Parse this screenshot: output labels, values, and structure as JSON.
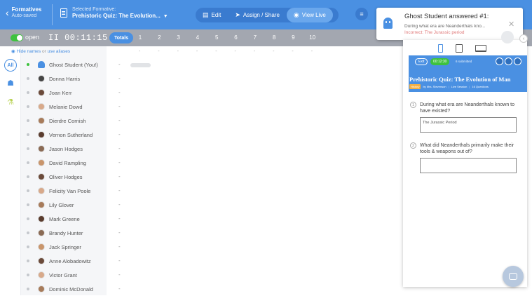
{
  "header": {
    "back_title": "Formatives",
    "back_status": "Auto-saved",
    "selected_label": "Selected Formative:",
    "selected_name": "Prehistoric Quiz: The Evolution...",
    "tabs": [
      {
        "label": "Edit",
        "icon": "edit-icon"
      },
      {
        "label": "Assign / Share",
        "icon": "send-icon"
      },
      {
        "label": "View Live",
        "icon": "eye-icon"
      }
    ],
    "active_tab": "View Live",
    "accent_color": "#4a90e2"
  },
  "subbar": {
    "open_label": "open",
    "timer": "II 00:11:15",
    "totals_label": "Totals",
    "question_numbers": [
      "1",
      "2",
      "3",
      "4",
      "5",
      "6",
      "7",
      "8",
      "9",
      "10"
    ]
  },
  "sidebar": {
    "all_label": "All",
    "hide_names": "Hide names",
    "or": "or",
    "use_aliases": "use aliases",
    "students": [
      {
        "name": "Ghost Student (You!)",
        "live": true,
        "avatar": "ghost"
      },
      {
        "name": "Donna Harris"
      },
      {
        "name": "Joan Kerr"
      },
      {
        "name": "Melanie Dowd"
      },
      {
        "name": "Dierdre Cornish"
      },
      {
        "name": "Vernon Sutherland"
      },
      {
        "name": "Jason Hodges"
      },
      {
        "name": "David Rampling"
      },
      {
        "name": "Oliver Hodges"
      },
      {
        "name": "Felicity Van Poole"
      },
      {
        "name": "Lily Glover"
      },
      {
        "name": "Mark Greene"
      },
      {
        "name": "Brandy Hunter"
      },
      {
        "name": "Jack Springer"
      },
      {
        "name": "Anne Alobadowitz"
      },
      {
        "name": "Victor Grant"
      },
      {
        "name": "Dominic McDonald"
      }
    ],
    "row_dash": "-"
  },
  "notification": {
    "title": "Ghost Student answered #1:",
    "question": "During what era are Neanderthals kno...",
    "answer": "Incorrect: The Jurassic period"
  },
  "preview": {
    "exit_label": "Exit",
    "timer": "00:12:30",
    "status": "6 submitted",
    "title": "Prehistoric Quiz: The Evolution of Man",
    "subject_badge": "History",
    "by": "by Mrs. Stevenson",
    "mode": "Live Session",
    "count": "16 Questions",
    "questions": [
      {
        "num": "1",
        "text": "During what era are Neanderthals known to have existed?",
        "answer": "The Jurassic Period"
      },
      {
        "num": "2",
        "text": "What did Neanderthals primarily make their tools & weapons out of?",
        "answer": ""
      }
    ]
  }
}
